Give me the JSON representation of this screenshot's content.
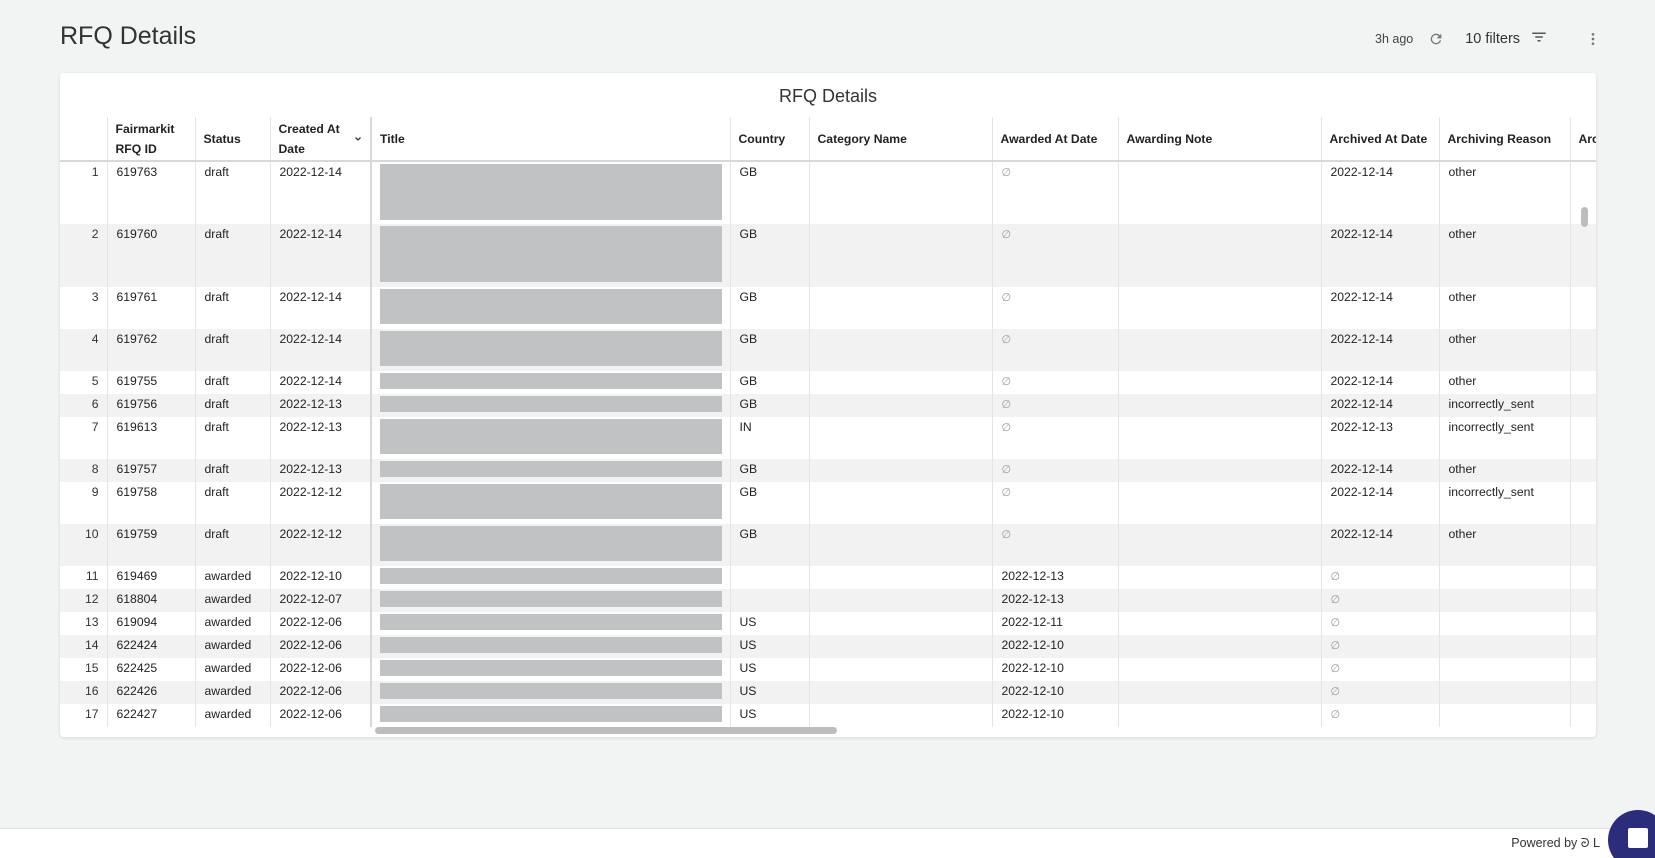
{
  "page": {
    "title": "RFQ Details"
  },
  "header": {
    "updated": "3h ago",
    "filters_label": "10 filters"
  },
  "card": {
    "title": "RFQ Details"
  },
  "columns": [
    "",
    "Fairmarkit RFQ ID",
    "Status",
    "Created At Date",
    "Title",
    "Country",
    "Category Name",
    "Awarded At Date",
    "Awarding Note",
    "Archived At Date",
    "Archiving Reason",
    "Arc"
  ],
  "rows": [
    {
      "n": "1",
      "id": "619763",
      "status": "draft",
      "created": "2022-12-14",
      "country": "GB",
      "category": "",
      "awarded": null,
      "note": "",
      "archived": "2022-12-14",
      "reason": "other",
      "h": 63,
      "bar": 56
    },
    {
      "n": "2",
      "id": "619760",
      "status": "draft",
      "created": "2022-12-14",
      "country": "GB",
      "category": "",
      "awarded": null,
      "note": "",
      "archived": "2022-12-14",
      "reason": "other",
      "h": 63,
      "bar": 56
    },
    {
      "n": "3",
      "id": "619761",
      "status": "draft",
      "created": "2022-12-14",
      "country": "GB",
      "category": "",
      "awarded": null,
      "note": "",
      "archived": "2022-12-14",
      "reason": "other",
      "h": 42,
      "bar": 35
    },
    {
      "n": "4",
      "id": "619762",
      "status": "draft",
      "created": "2022-12-14",
      "country": "GB",
      "category": "",
      "awarded": null,
      "note": "",
      "archived": "2022-12-14",
      "reason": "other",
      "h": 42,
      "bar": 35
    },
    {
      "n": "5",
      "id": "619755",
      "status": "draft",
      "created": "2022-12-14",
      "country": "GB",
      "category": "",
      "awarded": null,
      "note": "",
      "archived": "2022-12-14",
      "reason": "other",
      "h": 23,
      "bar": 16
    },
    {
      "n": "6",
      "id": "619756",
      "status": "draft",
      "created": "2022-12-13",
      "country": "GB",
      "category": "",
      "awarded": null,
      "note": "",
      "archived": "2022-12-14",
      "reason": "incorrectly_sent",
      "h": 23,
      "bar": 16
    },
    {
      "n": "7",
      "id": "619613",
      "status": "draft",
      "created": "2022-12-13",
      "country": "IN",
      "category": "",
      "awarded": null,
      "note": "",
      "archived": "2022-12-13",
      "reason": "incorrectly_sent",
      "h": 42,
      "bar": 35
    },
    {
      "n": "8",
      "id": "619757",
      "status": "draft",
      "created": "2022-12-13",
      "country": "GB",
      "category": "",
      "awarded": null,
      "note": "",
      "archived": "2022-12-14",
      "reason": "other",
      "h": 23,
      "bar": 16
    },
    {
      "n": "9",
      "id": "619758",
      "status": "draft",
      "created": "2022-12-12",
      "country": "GB",
      "category": "",
      "awarded": null,
      "note": "",
      "archived": "2022-12-14",
      "reason": "incorrectly_sent",
      "h": 42,
      "bar": 35
    },
    {
      "n": "10",
      "id": "619759",
      "status": "draft",
      "created": "2022-12-12",
      "country": "GB",
      "category": "",
      "awarded": null,
      "note": "",
      "archived": "2022-12-14",
      "reason": "other",
      "h": 42,
      "bar": 35
    },
    {
      "n": "11",
      "id": "619469",
      "status": "awarded",
      "created": "2022-12-10",
      "country": "",
      "category": "",
      "awarded": "2022-12-13",
      "note": "",
      "archived": null,
      "reason": "",
      "h": 23,
      "bar": 16
    },
    {
      "n": "12",
      "id": "618804",
      "status": "awarded",
      "created": "2022-12-07",
      "country": "",
      "category": "",
      "awarded": "2022-12-13",
      "note": "",
      "archived": null,
      "reason": "",
      "h": 23,
      "bar": 16
    },
    {
      "n": "13",
      "id": "619094",
      "status": "awarded",
      "created": "2022-12-06",
      "country": "US",
      "category": "",
      "awarded": "2022-12-11",
      "note": "",
      "archived": null,
      "reason": "",
      "h": 23,
      "bar": 16
    },
    {
      "n": "14",
      "id": "622424",
      "status": "awarded",
      "created": "2022-12-06",
      "country": "US",
      "category": "",
      "awarded": "2022-12-10",
      "note": "",
      "archived": null,
      "reason": "",
      "h": 23,
      "bar": 16
    },
    {
      "n": "15",
      "id": "622425",
      "status": "awarded",
      "created": "2022-12-06",
      "country": "US",
      "category": "",
      "awarded": "2022-12-10",
      "note": "",
      "archived": null,
      "reason": "",
      "h": 23,
      "bar": 16
    },
    {
      "n": "16",
      "id": "622426",
      "status": "awarded",
      "created": "2022-12-06",
      "country": "US",
      "category": "",
      "awarded": "2022-12-10",
      "note": "",
      "archived": null,
      "reason": "",
      "h": 23,
      "bar": 16
    },
    {
      "n": "17",
      "id": "622427",
      "status": "awarded",
      "created": "2022-12-06",
      "country": "US",
      "category": "",
      "awarded": "2022-12-10",
      "note": "",
      "archived": null,
      "reason": "",
      "h": 23,
      "bar": 16
    }
  ],
  "null_symbol": "∅",
  "footer": {
    "powered_by": "Powered by ᘒ L"
  },
  "icons": {
    "refresh": "refresh-icon",
    "filter": "filter-icon",
    "more": "more-vert-icon",
    "sort": "chevron-down-icon",
    "chat": "chat-launcher-icon"
  }
}
